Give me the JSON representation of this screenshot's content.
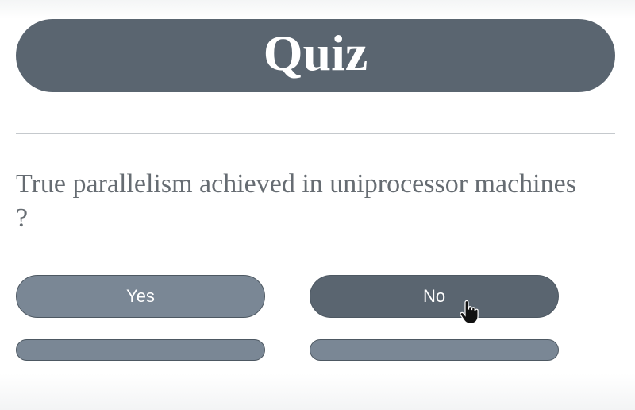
{
  "quiz": {
    "title": "Quiz",
    "question": "True parallelism achieved in uniprocessor machines ?",
    "answers": [
      {
        "label": "Yes"
      },
      {
        "label": "No"
      }
    ]
  },
  "cursor": {
    "icon": "hand-pointer-icon"
  },
  "colors": {
    "primary": "#5a6570",
    "secondary": "#7a8795",
    "question_text": "#666c72",
    "divider": "#c5c9cd"
  }
}
